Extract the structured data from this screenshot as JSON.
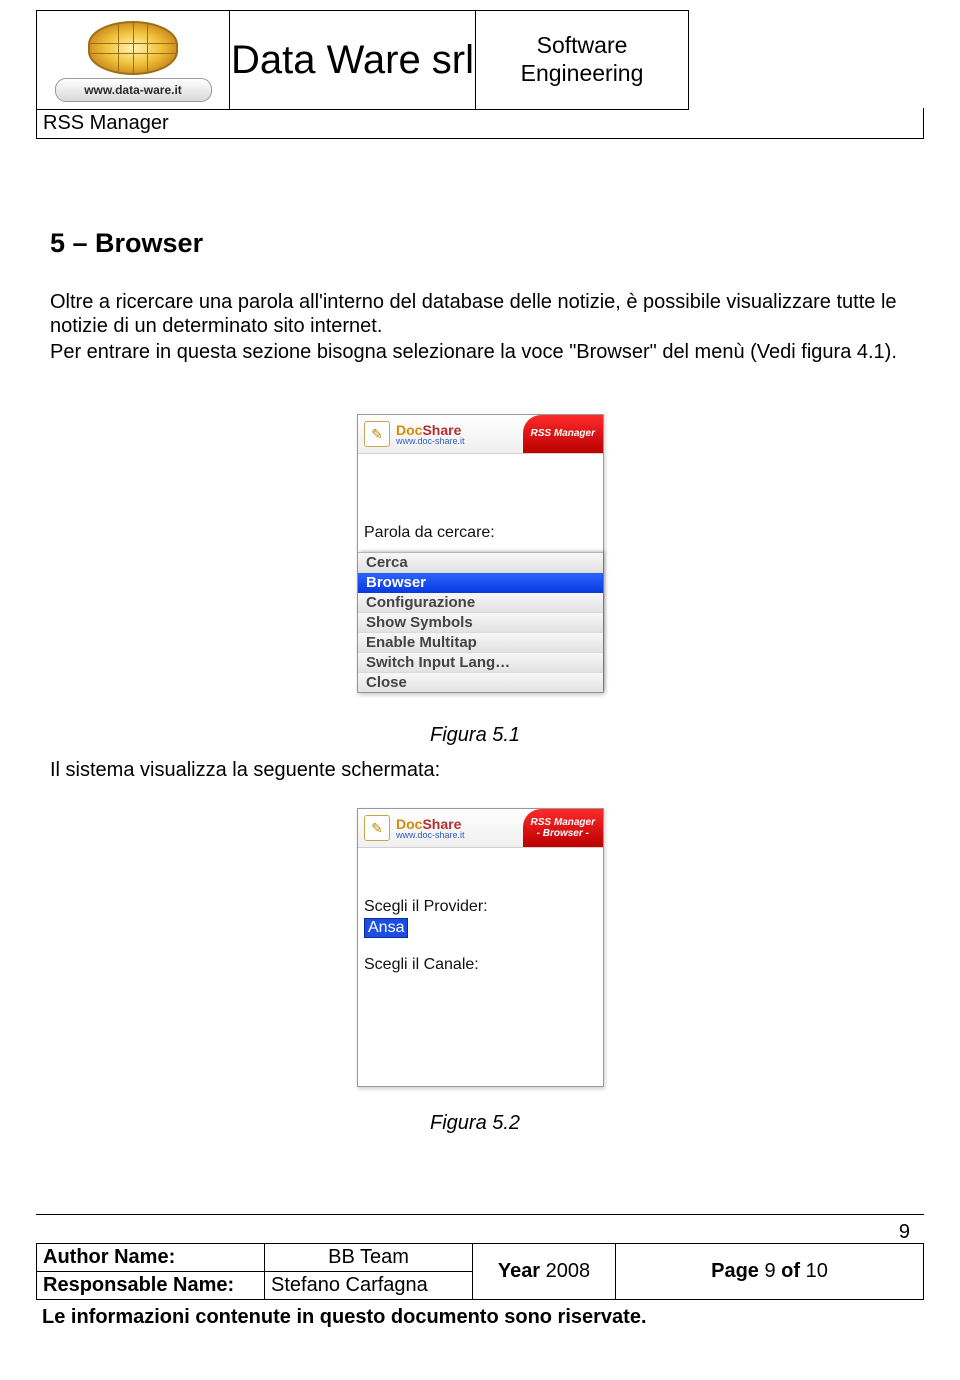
{
  "header": {
    "logo_url_text": "www.data-ware.it",
    "company": "Data Ware srl",
    "software": "Software",
    "engineering": "Engineering",
    "product": "RSS Manager"
  },
  "section_heading": "5 – Browser",
  "para1": "Oltre a ricercare una parola all'interno del database delle notizie, è possibile visualizzare tutte le notizie di un determinato sito internet.",
  "para2": "Per entrare in questa sezione bisogna selezionare la voce \"Browser\" del menù (Vedi figura 4.1).",
  "fig1": {
    "doc_a": "Doc",
    "doc_b": "Share",
    "doc_sub": "www.doc-share.it",
    "red_tab_l1": "RSS Manager",
    "search_label": "Parola da cercare:",
    "menu_items": [
      "Cerca",
      "Browser",
      "Configurazione",
      "Show Symbols",
      "Enable Multitap",
      "Switch Input Lang…",
      "Close"
    ],
    "caption": "Figura 5.1"
  },
  "after_fig1": "Il sistema visualizza la seguente schermata:",
  "fig2": {
    "red_tab_l1": "RSS Manager",
    "red_tab_l2": "- Browser -",
    "provider_label": "Scegli il Provider:",
    "provider_value": "Ansa",
    "channel_label": "Scegli il Canale:",
    "caption": "Figura 5.2"
  },
  "footer": {
    "author_label": "Author Name:",
    "author_value": "BB Team",
    "resp_label": "Responsable Name:",
    "resp_value": "Stefano Carfagna",
    "year_label": "Year",
    "year_value": "2008",
    "page_label": "Page",
    "page_value": "9",
    "page_of": "of",
    "page_total": "10",
    "solo_page": "9",
    "rights": "Le informazioni contenute in questo documento sono riservate."
  }
}
